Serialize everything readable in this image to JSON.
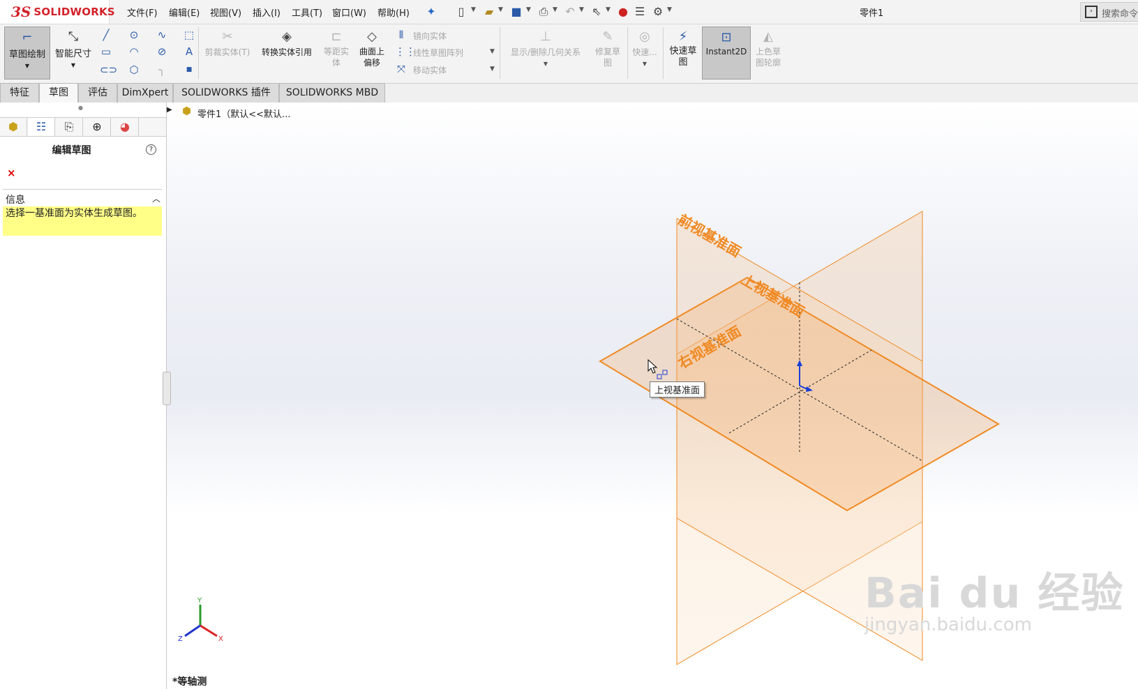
{
  "app": {
    "logo_ds": "3S",
    "logo_text": "SOLIDWORKS",
    "document_title": "零件1",
    "search_placeholder": "搜索命令"
  },
  "menu": [
    "文件(F)",
    "编辑(E)",
    "视图(V)",
    "插入(I)",
    "工具(T)",
    "窗口(W)",
    "帮助(H)"
  ],
  "ribbon": {
    "sketch": "草图绘制",
    "smart_dim": "智能尺寸",
    "trim": "剪裁实体(T)",
    "convert": "转换实体引用",
    "offset_line1": "等距实",
    "offset_line2": "体",
    "surface_offset_line1": "曲面上",
    "surface_offset_line2": "偏移",
    "mirror": "镜向实体",
    "linear_pattern": "线性草图阵列",
    "move": "移动实体",
    "relations": "显示/删除几何关系",
    "repair_line1": "修复草",
    "repair_line2": "图",
    "quick": "快速...",
    "quick_sketch_line1": "快速草",
    "quick_sketch_line2": "图",
    "instant2d": "Instant2D",
    "shaded_line1": "上色草",
    "shaded_line2": "图轮廓"
  },
  "tabs": [
    "特征",
    "草图",
    "评估",
    "DimXpert",
    "SOLIDWORKS 插件",
    "SOLIDWORKS MBD"
  ],
  "active_tab": "草图",
  "property_manager": {
    "title": "编辑草图",
    "help": "?",
    "close": "×",
    "info_header": "信息",
    "info_text": "选择一基准面为实体生成草图。"
  },
  "tree": {
    "part": "零件1（默认<<默认..."
  },
  "graphics": {
    "plane_front": "前视基准面",
    "plane_top": "上视基准面",
    "plane_right": "右视基准面",
    "tooltip": "上视基准面",
    "view_name": "*等轴测",
    "axis_x": "X",
    "axis_y": "Y",
    "axis_z": "Z",
    "plane_color": "#f08a24"
  },
  "watermark": {
    "brand": "Bai du 经验",
    "url": "jingyan.baidu.com"
  }
}
